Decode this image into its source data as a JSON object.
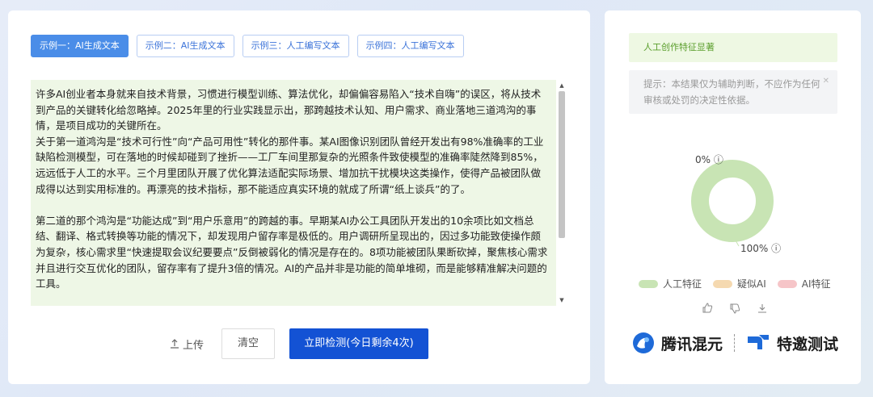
{
  "tabs": [
    {
      "label": "示例一：AI生成文本",
      "active": true
    },
    {
      "label": "示例二：AI生成文本",
      "active": false
    },
    {
      "label": "示例三：人工编写文本",
      "active": false
    },
    {
      "label": "示例四：人工编写文本",
      "active": false
    }
  ],
  "text": {
    "paragraphs": [
      "许多AI创业者本身就来自技术背景，习惯进行模型训练、算法优化，却偏偏容易陷入“技术自嗨”的误区，将从技术到产品的关键转化给忽略掉。2025年里的行业实践显示出，那跨越技术认知、用户需求、商业落地三道鸿沟的事情，是项目成功的关键所在。",
      "关于第一道鸿沟是“技术可行性”向“产品可用性”转化的那件事。某AI图像识别团队曾经开发出有98%准确率的工业缺陷检测模型，可在落地的时候却碰到了挫折——工厂车间里那复杂的光照条件致使模型的准确率陡然降到85%，远远低于人工的水平。三个月里团队开展了优化算法适配实际场景、增加抗干扰模块这类操作，使得产品被团队做成得以达到实用标准的。再漂亮的技术指标，那不能适应真实环境的就成了所谓“纸上谈兵”的了。",
      "",
      "第二道的那个鸿沟是“功能达成”到“用户乐意用”的跨越的事。早期某AI办公工具团队开发出的10余项比如文档总结、翻译、格式转换等功能的情况下，却发现用户留存率是极低的。用户调研所呈现出的，因过多功能致使操作颇为复杂，核心需求里“快速提取会议纪要要点”反倒被弱化的情况是存在的。8项功能被团队果断砍掉，聚焦核心需求并且进行交互优化的团队，留存率有了提升3倍的情况。AI的产品并非是功能的简单堆砌，而是能够精准解决问题的工具。"
    ]
  },
  "actions": {
    "upload_label": "上传",
    "clear_label": "清空",
    "detect_label": "立即检测(今日剩余4次)"
  },
  "result": {
    "banner": "人工创作特征显著",
    "notice": "提示：本结果仅为辅助判断，不应作为任何审核或处罚的决定性依据。",
    "pct_top": "0%",
    "pct_bottom": "100%",
    "human_ratio": 1.0,
    "ai_ratio": 0.0
  },
  "legend": [
    {
      "label": "人工特征",
      "color": "#c8e4b4"
    },
    {
      "label": "疑似AI",
      "color": "#f5d9b0"
    },
    {
      "label": "AI特征",
      "color": "#f6c5c8"
    }
  ],
  "brand": {
    "name1": "腾讯混元",
    "name2": "特邀测试"
  }
}
